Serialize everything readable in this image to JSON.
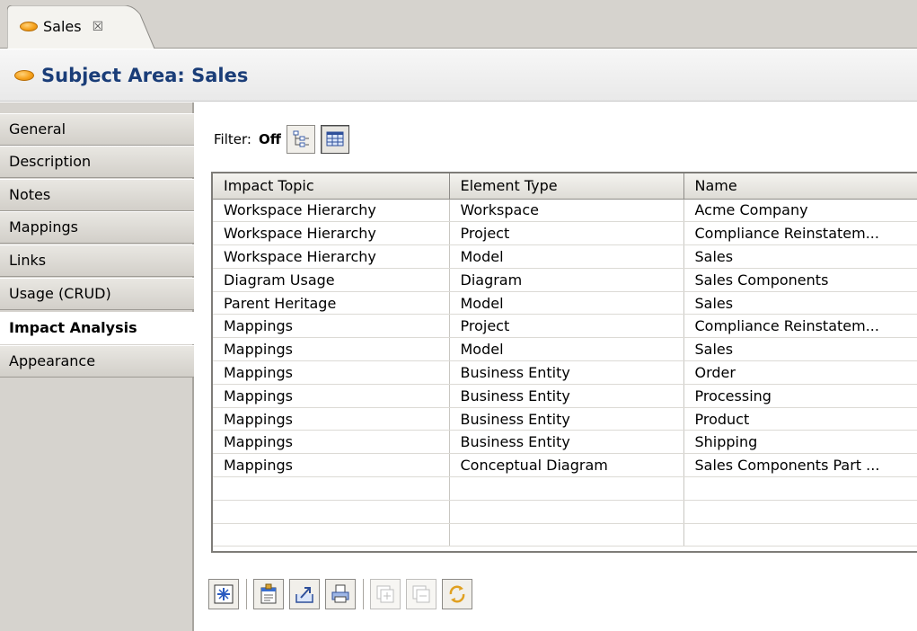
{
  "editor_tab": {
    "title": "Sales",
    "close_glyph": "☒"
  },
  "header": {
    "title": "Subject Area: Sales"
  },
  "sidebar": {
    "items": [
      {
        "label": "General"
      },
      {
        "label": "Description"
      },
      {
        "label": "Notes"
      },
      {
        "label": "Mappings"
      },
      {
        "label": "Links"
      },
      {
        "label": "Usage (CRUD)"
      },
      {
        "label": "Impact Analysis",
        "active": true
      },
      {
        "label": "Appearance"
      }
    ]
  },
  "filter": {
    "label": "Filter:",
    "value": "Off"
  },
  "table": {
    "columns": [
      "Impact Topic",
      "Element Type",
      "Name"
    ],
    "rows": [
      [
        "Workspace Hierarchy",
        "Workspace",
        "Acme Company"
      ],
      [
        "Workspace Hierarchy",
        "Project",
        "Compliance Reinstatem..."
      ],
      [
        "Workspace Hierarchy",
        "Model",
        "Sales"
      ],
      [
        "Diagram Usage",
        "Diagram",
        "Sales Components"
      ],
      [
        "Parent Heritage",
        "Model",
        "Sales"
      ],
      [
        "Mappings",
        "Project",
        "Compliance Reinstatem..."
      ],
      [
        "Mappings",
        "Model",
        "Sales"
      ],
      [
        "Mappings",
        "Business Entity",
        "Order"
      ],
      [
        "Mappings",
        "Business Entity",
        "Processing"
      ],
      [
        "Mappings",
        "Business Entity",
        "Product"
      ],
      [
        "Mappings",
        "Business Entity",
        "Shipping"
      ],
      [
        "Mappings",
        "Conceptual Diagram",
        "Sales Components Part ..."
      ]
    ]
  },
  "toolbar_icons": {
    "filter": [
      "tree-view-icon",
      "grid-view-icon"
    ],
    "bottom": [
      "select-all-icon",
      "properties-icon",
      "export-icon",
      "print-icon",
      "expand-all-icon",
      "collapse-all-icon",
      "refresh-icon"
    ]
  },
  "colors": {
    "accent": "#1a3d78",
    "chrome": "#d6d3ce",
    "oval": "#f6a21c"
  }
}
